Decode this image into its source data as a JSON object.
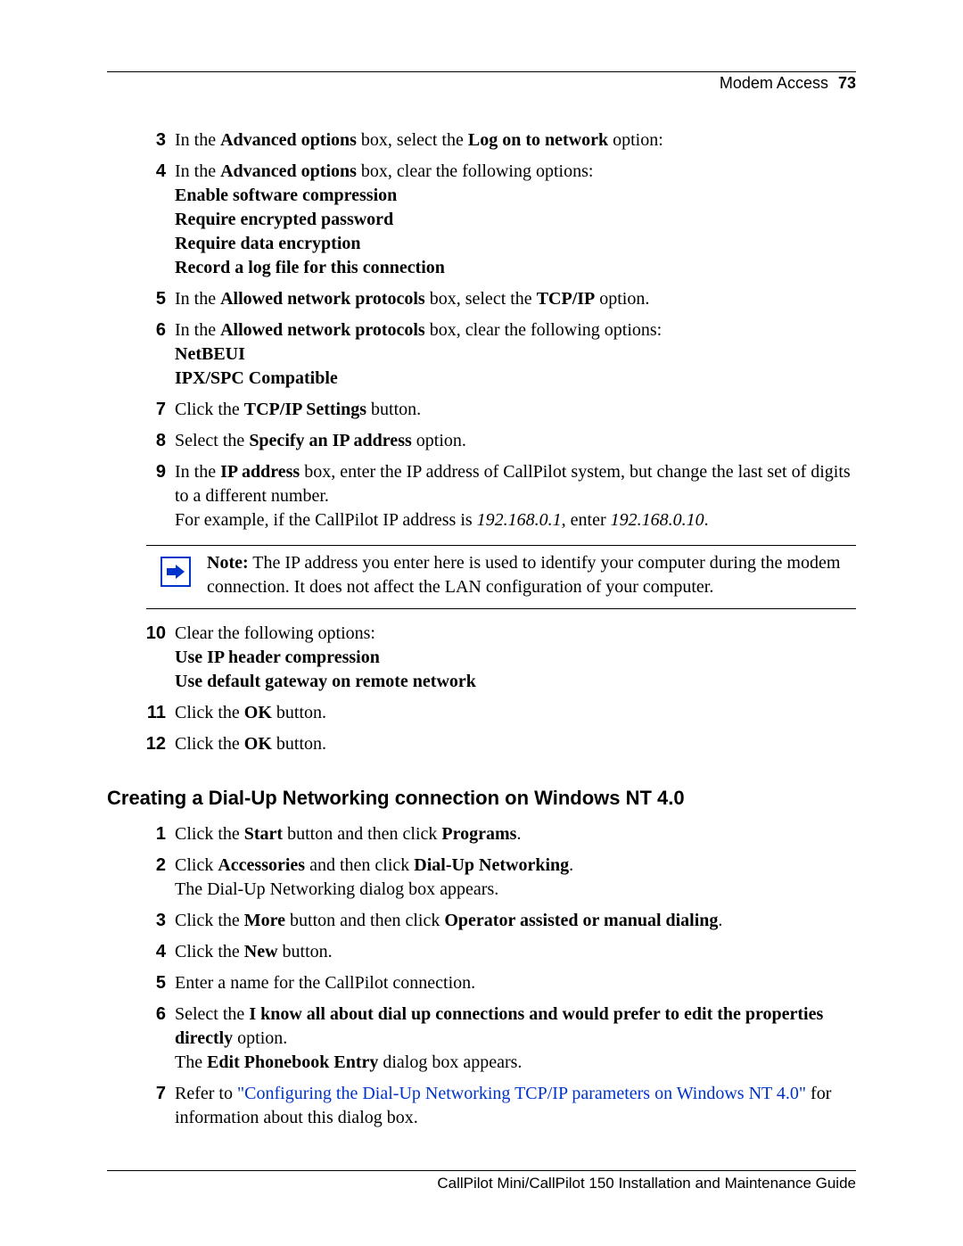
{
  "header": {
    "title": "Modem Access",
    "page": "73"
  },
  "steps_a": [
    {
      "n": "3",
      "parts": [
        {
          "t": "In the "
        },
        {
          "t": "Advanced options",
          "b": true
        },
        {
          "t": " box, select the "
        },
        {
          "t": "Log on to network",
          "b": true
        },
        {
          "t": " option:"
        }
      ]
    },
    {
      "n": "4",
      "parts": [
        {
          "t": "In the "
        },
        {
          "t": "Advanced options",
          "b": true
        },
        {
          "t": " box, clear the following options:"
        },
        {
          "br": true
        },
        {
          "t": "Enable software compression",
          "b": true
        },
        {
          "br": true
        },
        {
          "t": "Require encrypted password",
          "b": true
        },
        {
          "br": true
        },
        {
          "t": "Require data encryption",
          "b": true
        },
        {
          "br": true
        },
        {
          "t": "Record a log file for this connection",
          "b": true
        }
      ]
    },
    {
      "n": "5",
      "parts": [
        {
          "t": "In the "
        },
        {
          "t": "Allowed network protocols",
          "b": true
        },
        {
          "t": " box, select the "
        },
        {
          "t": "TCP/IP",
          "b": true
        },
        {
          "t": " option."
        }
      ]
    },
    {
      "n": "6",
      "parts": [
        {
          "t": "In the "
        },
        {
          "t": "Allowed network protocols",
          "b": true
        },
        {
          "t": " box, clear the following options:"
        },
        {
          "br": true
        },
        {
          "t": "NetBEUI",
          "b": true
        },
        {
          "br": true
        },
        {
          "t": "IPX/SPC Compatible",
          "b": true
        }
      ]
    },
    {
      "n": "7",
      "parts": [
        {
          "t": "Click the "
        },
        {
          "t": "TCP/IP Settings",
          "b": true
        },
        {
          "t": " button."
        }
      ]
    },
    {
      "n": "8",
      "parts": [
        {
          "t": "Select the "
        },
        {
          "t": "Specify an IP address",
          "b": true
        },
        {
          "t": " option."
        }
      ]
    },
    {
      "n": "9",
      "parts": [
        {
          "t": "In the "
        },
        {
          "t": "IP address",
          "b": true
        },
        {
          "t": " box, enter the IP address of CallPilot system, but change the last set of digits to a different number."
        },
        {
          "br": true
        },
        {
          "t": "For example, if the CallPilot IP address is "
        },
        {
          "t": "192.168.0.1",
          "i": true
        },
        {
          "t": ", enter "
        },
        {
          "t": "192.168.0.10",
          "i": true
        },
        {
          "t": "."
        }
      ]
    }
  ],
  "note": {
    "label": "Note:",
    "text": " The IP address you enter here is used to identify your computer during the modem connection. It does not affect the LAN configuration of your computer."
  },
  "steps_b": [
    {
      "n": "10",
      "parts": [
        {
          "t": "Clear the following options:"
        },
        {
          "br": true
        },
        {
          "t": "Use IP header compression",
          "b": true
        },
        {
          "br": true
        },
        {
          "t": "Use default gateway on remote network",
          "b": true
        }
      ]
    },
    {
      "n": "11",
      "parts": [
        {
          "t": "Click the "
        },
        {
          "t": "OK",
          "b": true
        },
        {
          "t": " button."
        }
      ]
    },
    {
      "n": "12",
      "parts": [
        {
          "t": "Click the "
        },
        {
          "t": "OK",
          "b": true
        },
        {
          "t": " button."
        }
      ]
    }
  ],
  "section_heading": "Creating a Dial-Up Networking connection on Windows NT 4.0",
  "steps_c": [
    {
      "n": "1",
      "parts": [
        {
          "t": "Click the "
        },
        {
          "t": "Start",
          "b": true
        },
        {
          "t": " button and then click "
        },
        {
          "t": "Programs",
          "b": true
        },
        {
          "t": "."
        }
      ]
    },
    {
      "n": "2",
      "parts": [
        {
          "t": "Click "
        },
        {
          "t": "Accessories",
          "b": true
        },
        {
          "t": " and then click "
        },
        {
          "t": "Dial-Up Networking",
          "b": true
        },
        {
          "t": "."
        },
        {
          "br": true
        },
        {
          "t": "The Dial-Up Networking dialog box appears."
        }
      ]
    },
    {
      "n": "3",
      "parts": [
        {
          "t": "Click the "
        },
        {
          "t": "More",
          "b": true
        },
        {
          "t": " button and then click "
        },
        {
          "t": "Operator assisted or manual dialing",
          "b": true
        },
        {
          "t": "."
        }
      ]
    },
    {
      "n": "4",
      "parts": [
        {
          "t": "Click the "
        },
        {
          "t": "New",
          "b": true
        },
        {
          "t": " button."
        }
      ]
    },
    {
      "n": "5",
      "parts": [
        {
          "t": "Enter a name for the CallPilot connection."
        }
      ]
    },
    {
      "n": "6",
      "parts": [
        {
          "t": "Select the "
        },
        {
          "t": "I know all about dial up connections and would prefer to edit the properties directly",
          "b": true
        },
        {
          "t": " option."
        },
        {
          "br": true
        },
        {
          "t": "The "
        },
        {
          "t": "Edit Phonebook Entry",
          "b": true
        },
        {
          "t": " dialog box appears."
        }
      ]
    },
    {
      "n": "7",
      "parts": [
        {
          "t": "Refer to "
        },
        {
          "t": "\"Configuring the Dial-Up Networking TCP/IP parameters on Windows NT 4.0\"",
          "link": true
        },
        {
          "t": " for information about this dialog box."
        }
      ]
    }
  ],
  "footer": "CallPilot Mini/CallPilot 150 Installation and Maintenance Guide"
}
